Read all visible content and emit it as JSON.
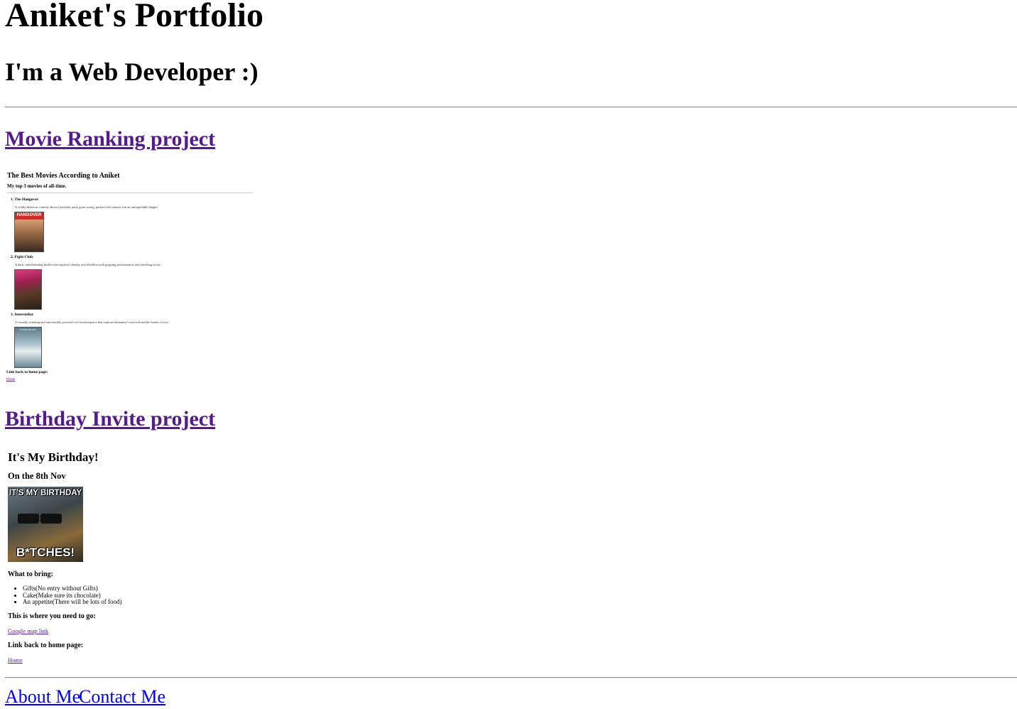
{
  "header": {
    "title": "Aniket's Portfolio",
    "subtitle": "I'm a Web Developer :)"
  },
  "projects": [
    {
      "link": "Movie Ranking project",
      "preview": {
        "title": "The Best Movies According to Aniket",
        "subtitle": "My top 3 movies of all-time.",
        "movies": [
          {
            "name": "1. The Hangover",
            "desc": "A wildly hilarious comedy about a bachelor party gone wrong, packed with chaotic fun an unforgettable laughs.",
            "poster": "HANGOVER"
          },
          {
            "name": "2. Fight Club",
            "desc": "A dark, mind-bending thriller that explores identity and rebellion with gripping performances and shocking twists.",
            "poster": ""
          },
          {
            "name": "3. Interstellar",
            "desc": "A visually stunning and emotionally powerful sci-fi masterpiece that explores humanity's survival and the bonds of love.",
            "poster": "INTERSTELLAR"
          }
        ],
        "back_label": "Link back to home page:",
        "home_link": "Home"
      }
    },
    {
      "link": "Birthday Invite project",
      "preview": {
        "heading": "It's My Birthday!",
        "date": "On the 8th Nov",
        "meme_top": "IT'S MY BIRTHDAY",
        "meme_bottom": "B*TCHES!",
        "bring_label": "What to bring:",
        "items": [
          "Gifts(No entry without Gifts)",
          "Cake(Make sure its chocolate)",
          "An appetite(There will be lots of food)"
        ],
        "where_label": "This is where you need to go:",
        "map_link": "Google map link",
        "back_label": "Link back to home page:",
        "home_link": "Home"
      }
    }
  ],
  "footer": {
    "about": "About Me",
    "contact": "Contact Me"
  },
  "colors": {
    "visited_link": "#551a8b",
    "link": "#0000ee",
    "rule": "#8a8a8a"
  }
}
